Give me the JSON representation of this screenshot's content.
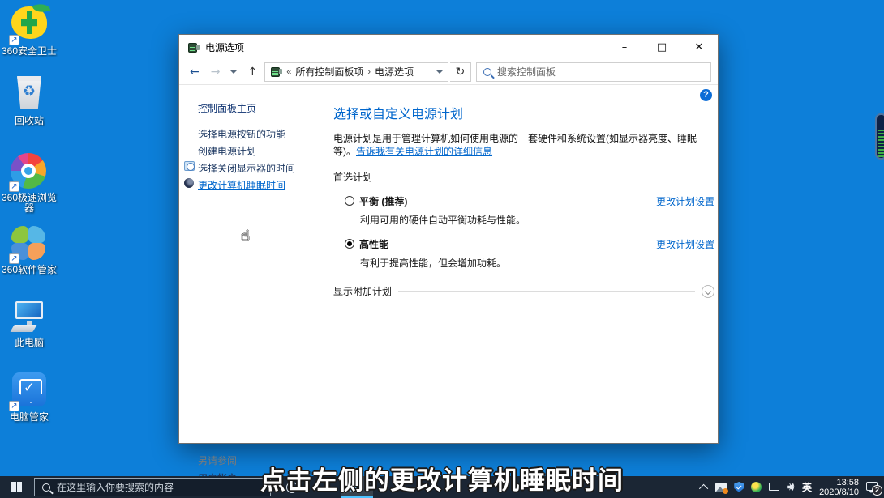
{
  "colors": {
    "desktop": "#0d7fd9",
    "taskbar": "#1b2634",
    "link_blue": "#0066cc",
    "heading_blue": "#0066cc",
    "active_underline": "#4cc2ff"
  },
  "desktop": {
    "icons": [
      {
        "label": "360安全卫士",
        "icon": "360-safety-shield-icon"
      },
      {
        "label": "回收站",
        "icon": "recycle-bin-icon",
        "glyph": "♻"
      },
      {
        "label": "360极速浏览\n器",
        "icon": "360-browser-pinwheel-icon"
      },
      {
        "label": "360软件管家",
        "icon": "360-software-flower-icon"
      },
      {
        "label": "此电脑",
        "icon": "this-pc-monitor-icon"
      },
      {
        "label": "电脑管家",
        "icon": "pc-manager-shield-icon"
      }
    ]
  },
  "window": {
    "title": "电源选项",
    "titlebar": {
      "minimize": "–",
      "maximize": "□",
      "close": "✕"
    },
    "nav": {
      "back": "←",
      "forward": "→",
      "up": "↑",
      "refresh": "↻",
      "chevrons": "«",
      "crumb_sep": "›",
      "breadcrumb": [
        "所有控制面板项",
        "电源选项"
      ],
      "search_placeholder": "搜索控制面板"
    },
    "help": "?",
    "sidebar": {
      "home": "控制面板主页",
      "items": [
        {
          "label": "选择电源按钮的功能"
        },
        {
          "label": "创建电源计划"
        },
        {
          "label": "选择关闭显示器的时间",
          "icon": "display-clock-icon"
        },
        {
          "label": "更改计算机睡眠时间",
          "icon": "sleep-moon-icon",
          "hovered": true
        }
      ],
      "see_also": "另请参阅",
      "see_also_links": [
        "用户帐户"
      ]
    },
    "main": {
      "heading": "选择或自定义电源计划",
      "description": "电源计划是用于管理计算机如何使用电源的一套硬件和系统设置(如显示器亮度、睡眠等)。",
      "description_link": "告诉我有关电源计划的详细信息",
      "section_preferred": "首选计划",
      "plans": [
        {
          "label": "平衡 (推荐)",
          "desc": "利用可用的硬件自动平衡功耗与性能。",
          "selected": false,
          "link": "更改计划设置"
        },
        {
          "label": "高性能",
          "desc": "有利于提高性能，但会增加功耗。",
          "selected": true,
          "link": "更改计划设置"
        }
      ],
      "section_additional": "显示附加计划"
    }
  },
  "taskbar": {
    "search_placeholder": "在这里输入你要搜索的内容",
    "tray": {
      "ime": "英",
      "time": "13:58",
      "date": "2020/8/10",
      "notification_count": "2"
    }
  },
  "subtitle": "点击左侧的更改计算机睡眠时间",
  "cursor": {
    "type": "hand-pointer",
    "glyph": "☝"
  }
}
